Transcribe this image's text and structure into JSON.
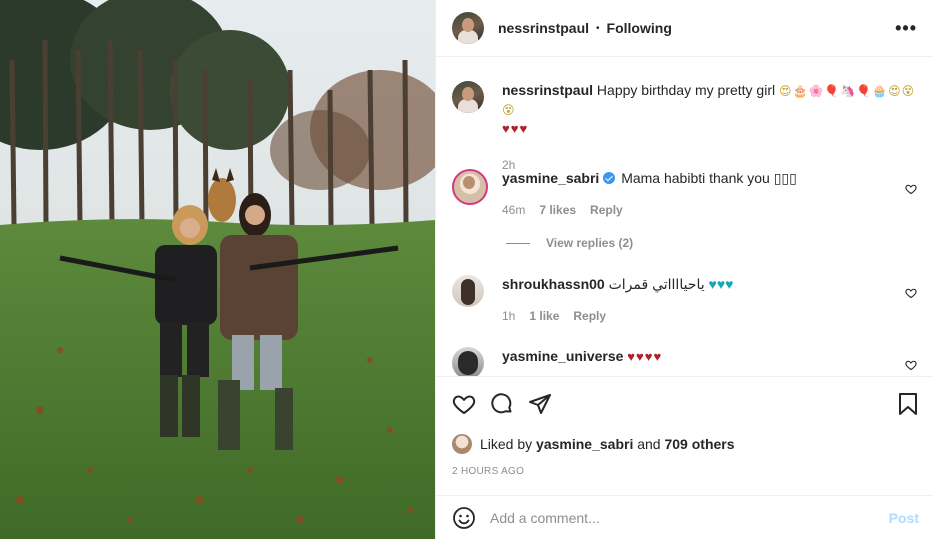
{
  "post": {
    "author": "nessrinstpaul",
    "follow_status": "Following",
    "more_glyph": "•••",
    "separator": "•"
  },
  "caption": {
    "username": "nessrinstpaul",
    "text": "Happy birthday my pretty girl",
    "emojis": "😍🎂🌸🎈🦄🎈🧁😍😵😵",
    "hearts": "♥♥♥",
    "time": "2h"
  },
  "comments": [
    {
      "username": "yasmine_sabri",
      "verified": true,
      "text": "Mama habibti thank you",
      "suffix": "▯▯▯",
      "time": "46m",
      "likes": "7 likes",
      "reply": "Reply"
    },
    {
      "username": "shroukhassn00",
      "text": "ياحيااااتي قمرات",
      "suffix": "♥♥♥",
      "time": "1h",
      "likes": "1 like",
      "reply": "Reply"
    },
    {
      "username": "yasmine_universe",
      "text": "♥♥♥♥"
    }
  ],
  "view_replies": "View replies (2)",
  "likes": {
    "prefix": "Liked by",
    "user": "yasmine_sabri",
    "joiner": "and",
    "others": "709 others"
  },
  "timestamp": "2 HOURS AGO",
  "composer": {
    "placeholder": "Add a comment...",
    "post_label": "Post"
  },
  "colors": {
    "link_blue": "#3897f0",
    "post_disabled": "#b3dbff",
    "meta_gray": "#8e8e8e",
    "heart_red": "#b0202a"
  }
}
